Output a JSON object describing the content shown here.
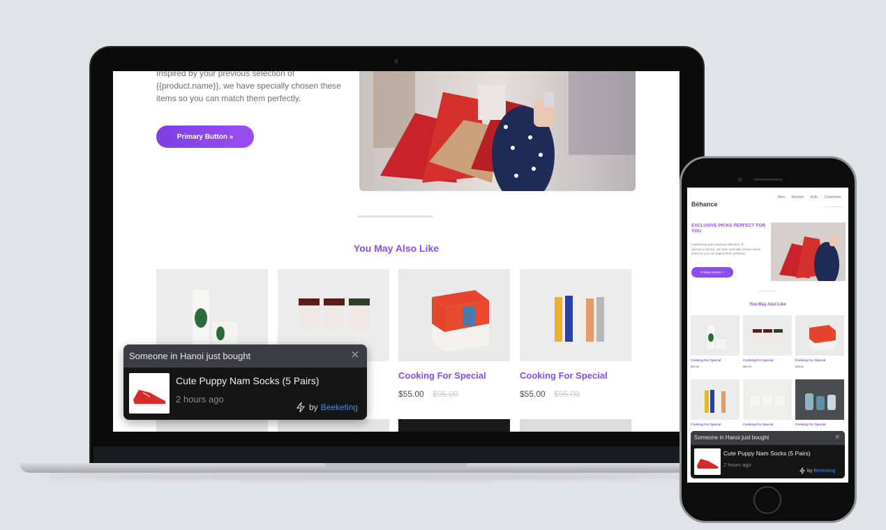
{
  "laptop": {
    "hero_text": "Inspired by your previous selection of {{product.name}}, we have specially chosen these items so you can match them perfectly.",
    "primary_button": "Primary Button »",
    "section_title": "You May Also Like",
    "products": [
      {
        "title": "Cooking For Special",
        "price": "$55.00",
        "old_price": "$95.00",
        "image": "skincare-tube-icon"
      },
      {
        "title": "Cooking For Special",
        "price": "$55.00",
        "old_price": "$95.00",
        "image": "jam-jars-icon"
      },
      {
        "title": "Cooking For Special",
        "price": "$55.00",
        "old_price": "$95.00",
        "image": "red-box-icon"
      },
      {
        "title": "Cooking For Special",
        "price": "$55.00",
        "old_price": "$95.00",
        "image": "bottles-icon"
      }
    ],
    "notification": {
      "header": "Someone in Hanoi just bought",
      "close": "✕",
      "product": "Cute Puppy Nam Socks (5 Pairs)",
      "time": "2 hours ago",
      "by": "by",
      "brand": "Beeketing"
    }
  },
  "phone": {
    "logo": "Bēhance",
    "nav": [
      "Men",
      "Women",
      "Kids",
      "Customize"
    ],
    "headline": "EXCLUSIVE PICKS PERFECT FOR YOU",
    "body": "Inspired by your previous selection of {{product.name}}, we have specially chosen these items so you can match them perfectly.",
    "button": "Primary Button »",
    "section_title": "You May Also Like",
    "products": [
      {
        "title": "Cooking For Special",
        "price": "$55.00",
        "old_price": "$95.00"
      },
      {
        "title": "Cooking For Special",
        "price": "$55.00",
        "old_price": "$95.00"
      },
      {
        "title": "Cooking For Special",
        "price": "$55.00",
        "old_price": "$95.00"
      },
      {
        "title": "Cooking For Special"
      },
      {
        "title": "Cooking For Special"
      },
      {
        "title": "Cooking For Special"
      }
    ],
    "notification": {
      "header": "Someone in Hanoi just bought",
      "close": "✕",
      "product": "Cute Puppy Nam Socks (5 Pairs)",
      "time": "2 hours ago",
      "by": "by",
      "brand": "Beeketing"
    }
  },
  "colors": {
    "accent": "#8a4de6",
    "button": "#7b3fe4",
    "brand_link": "#3d8cf0"
  }
}
